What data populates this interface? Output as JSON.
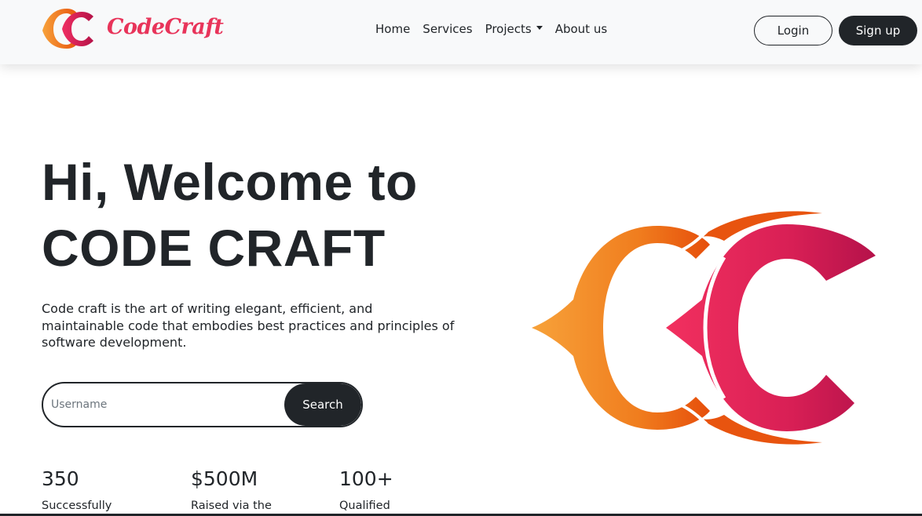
{
  "brand": {
    "name": "CodeCraft",
    "icon": "cc-logo-icon",
    "colors": {
      "orange": "#f28c28",
      "deep_orange": "#e8540f",
      "pink": "#e8345a",
      "crimson": "#c2134f"
    }
  },
  "nav": {
    "links": [
      {
        "label": "Home"
      },
      {
        "label": "Services"
      },
      {
        "label": "Projects",
        "has_dropdown": true
      },
      {
        "label": "About us"
      }
    ],
    "login_label": "Login",
    "signup_label": "Sign up"
  },
  "hero": {
    "title_line1": "Hi, Welcome to",
    "title_line2": "CODE CRAFT",
    "description": "Code craft is the art of writing elegant, efficient, and maintainable code that embodies best practices and principles of software development.",
    "search": {
      "placeholder": "Username",
      "value": "",
      "button_label": "Search"
    }
  },
  "stats": [
    {
      "value": "350",
      "label": "Successfully"
    },
    {
      "value": "$500M",
      "label": "Raised via the"
    },
    {
      "value": "100+",
      "label": "Qualified"
    }
  ],
  "colors": {
    "dark": "#212529",
    "navbar_bg": "#f8f9fa",
    "page_bg": "#ffffff"
  }
}
